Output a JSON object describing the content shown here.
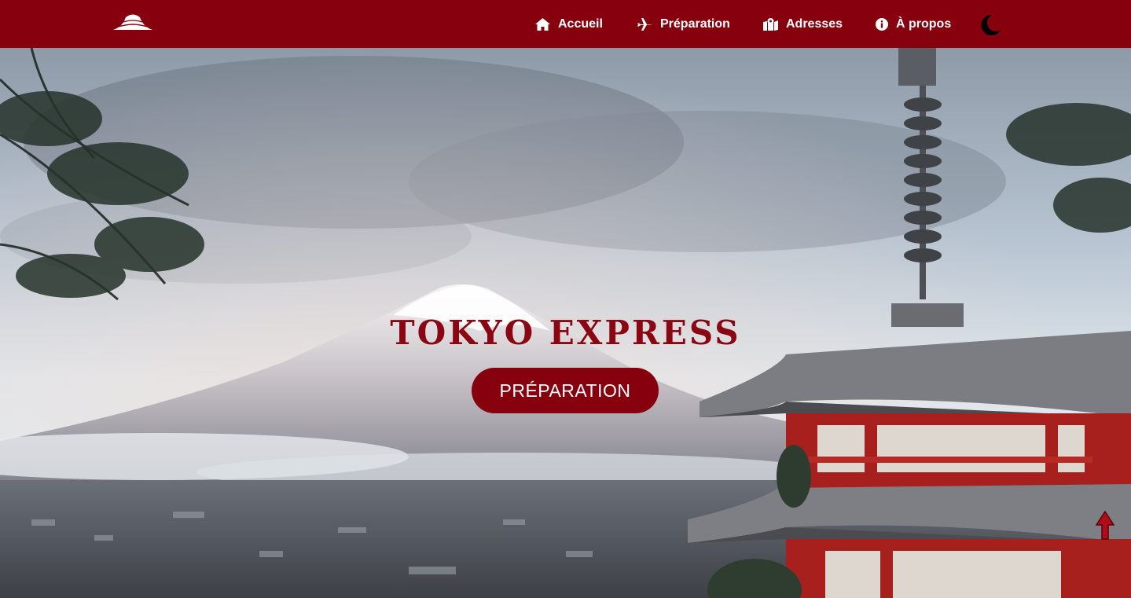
{
  "navbar": {
    "logo_icon": "mount-fuji-logo-icon",
    "items": [
      {
        "label": "Accueil",
        "icon": "home-icon"
      },
      {
        "label": "Préparation",
        "icon": "plane-icon"
      },
      {
        "label": "Adresses",
        "icon": "map-marked-icon"
      },
      {
        "label": "À propos",
        "icon": "info-circle-icon"
      }
    ],
    "theme_toggle_icon": "moon-icon"
  },
  "hero": {
    "title": "TOKYO EXPRESS",
    "button_label": "PRÉPARATION",
    "scroll_top_icon": "arrow-up-icon"
  },
  "colors": {
    "brand": "#86000e",
    "title": "#8a0612",
    "text_on_brand": "#ffffff"
  }
}
